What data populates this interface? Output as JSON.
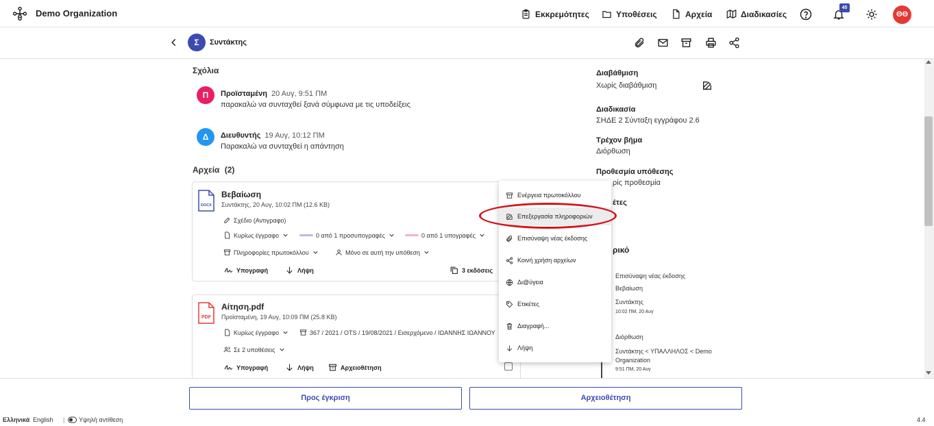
{
  "header": {
    "org_name": "Demo Organization",
    "nav": [
      {
        "label": "Εκκρεμότητες",
        "icon": "clipboard-icon"
      },
      {
        "label": "Υποθέσεις",
        "icon": "folder-icon"
      },
      {
        "label": "Αρχεία",
        "icon": "file-icon"
      },
      {
        "label": "Διαδικασίες",
        "icon": "map-icon"
      }
    ],
    "notification_count": "45",
    "user_initials": "ΘΘ"
  },
  "subheader": {
    "avatar_letter": "Σ",
    "title": "Συντάκτης"
  },
  "comments": {
    "heading": "Σχόλια",
    "items": [
      {
        "avatar": "Π",
        "author": "Προϊσταμένη",
        "time": "20 Αυγ, 9:51 ΠΜ",
        "text": "παρακαλώ να συνταχθεί ξανά σύμφωνα με τις υποδείξεις",
        "color": "#e91e63"
      },
      {
        "avatar": "Δ",
        "author": "Διευθυντής",
        "time": "19 Αυγ, 10:12 ΠΜ",
        "text": "Παρακαλώ να συνταχθεί η απάντηση",
        "color": "#2196f3"
      }
    ]
  },
  "files": {
    "heading": "Αρχεία",
    "count": "(2)",
    "items": [
      {
        "name": "Βεβαίωση",
        "type_label": "DOCX",
        "meta": "Συντάκτης, 20 Αυγ, 10:02 ΠΜ (12.6 KB)",
        "draft": "Σχέδιο (Αντιγραφο)",
        "doc_type": "Κυρίως έγγραφο",
        "cosign": "0 από 1 προσυπογραφές",
        "sign": "0 από 1 υπογραφές",
        "protocol": "Πληροφορίες πρωτοκόλλου",
        "scope": "Μόνο σε αυτή την υπόθεση",
        "sign_action": "Υπογραφή",
        "download_action": "Λήψη",
        "versions": "3 εκδόσεις"
      },
      {
        "name": "Αίτηση.pdf",
        "type_label": "PDF",
        "meta": "Προϊσταμένη, 19 Αυγ, 10:09 ΠΜ (25.8 KB)",
        "doc_type": "Κυρίως έγγραφο",
        "protocol_info": "367 / 2021 / OTS / 19/08/2021 / Εισερχόμενο / ΙΩΑΝΝΗΣ ΙΩΑΝΝΟΥ",
        "cases": "Σε 2 υποθέσεις",
        "sign_action": "Υπογραφή",
        "download_action": "Λήψη",
        "archive_action": "Αρχειοθέτηση"
      }
    ]
  },
  "context_menu": {
    "items": [
      {
        "label": "Ενέργεια πρωτοκόλλου",
        "icon": "archive-icon"
      },
      {
        "label": "Επεξεργασία πληροφοριών",
        "icon": "edit-icon"
      },
      {
        "label": "Επισύναψη νέας έκδοσης",
        "icon": "paperclip-icon"
      },
      {
        "label": "Κοινή χρήση αρχείων",
        "icon": "share-icon"
      },
      {
        "label": "Δι@ύγεια",
        "icon": "globe-icon"
      },
      {
        "label": "Ετικέτες",
        "icon": "tag-icon"
      },
      {
        "label": "Διαγραφή...",
        "icon": "trash-icon"
      },
      {
        "label": "Λήψη",
        "icon": "download-icon"
      }
    ]
  },
  "right_panel": {
    "classification_label": "Διαβάθμιση",
    "classification_value": "Χωρίς διαβάθμιση",
    "process_label": "Διαδικασία",
    "process_value": "ΣΗΔΕ 2 Σύνταξη εγγράφου 2.6",
    "step_label": "Τρέχον βήμα",
    "step_value": "Διόρθωση",
    "deadline_label": "Προθεσμία υπόθεσης",
    "deadline_value_visible": "ρίς προθεσμία",
    "tags_label_visible": "έτες",
    "history_label_visible": "ρικό",
    "history": {
      "e1_action": "Επισύναψη νέας έκδοσης",
      "e1_file": "Βεβαίωση",
      "e1_actor": "Συντάκτης",
      "e1_time": "10:02 ΠΜ, 20 Αυγ",
      "e2_action": "Διόρθωση",
      "e2_path": "Συντάκτης < ΥΠΑΛΛΗΛΟΣ < Demo",
      "e2_path2": "Organization",
      "e2_time": "9:51 ΠΜ, 20 Αυγ"
    }
  },
  "footer": {
    "approve_button": "Προς έγκριση",
    "archive_button": "Αρχειοθέτηση",
    "lang_greek": "Ελληνικά",
    "lang_english": "English",
    "contrast": "Υψηλή αντίθεση",
    "version": "4.4"
  },
  "colors": {
    "accent": "#3b4bb0",
    "danger": "#e53935",
    "highlight_ring": "#d4141c"
  }
}
